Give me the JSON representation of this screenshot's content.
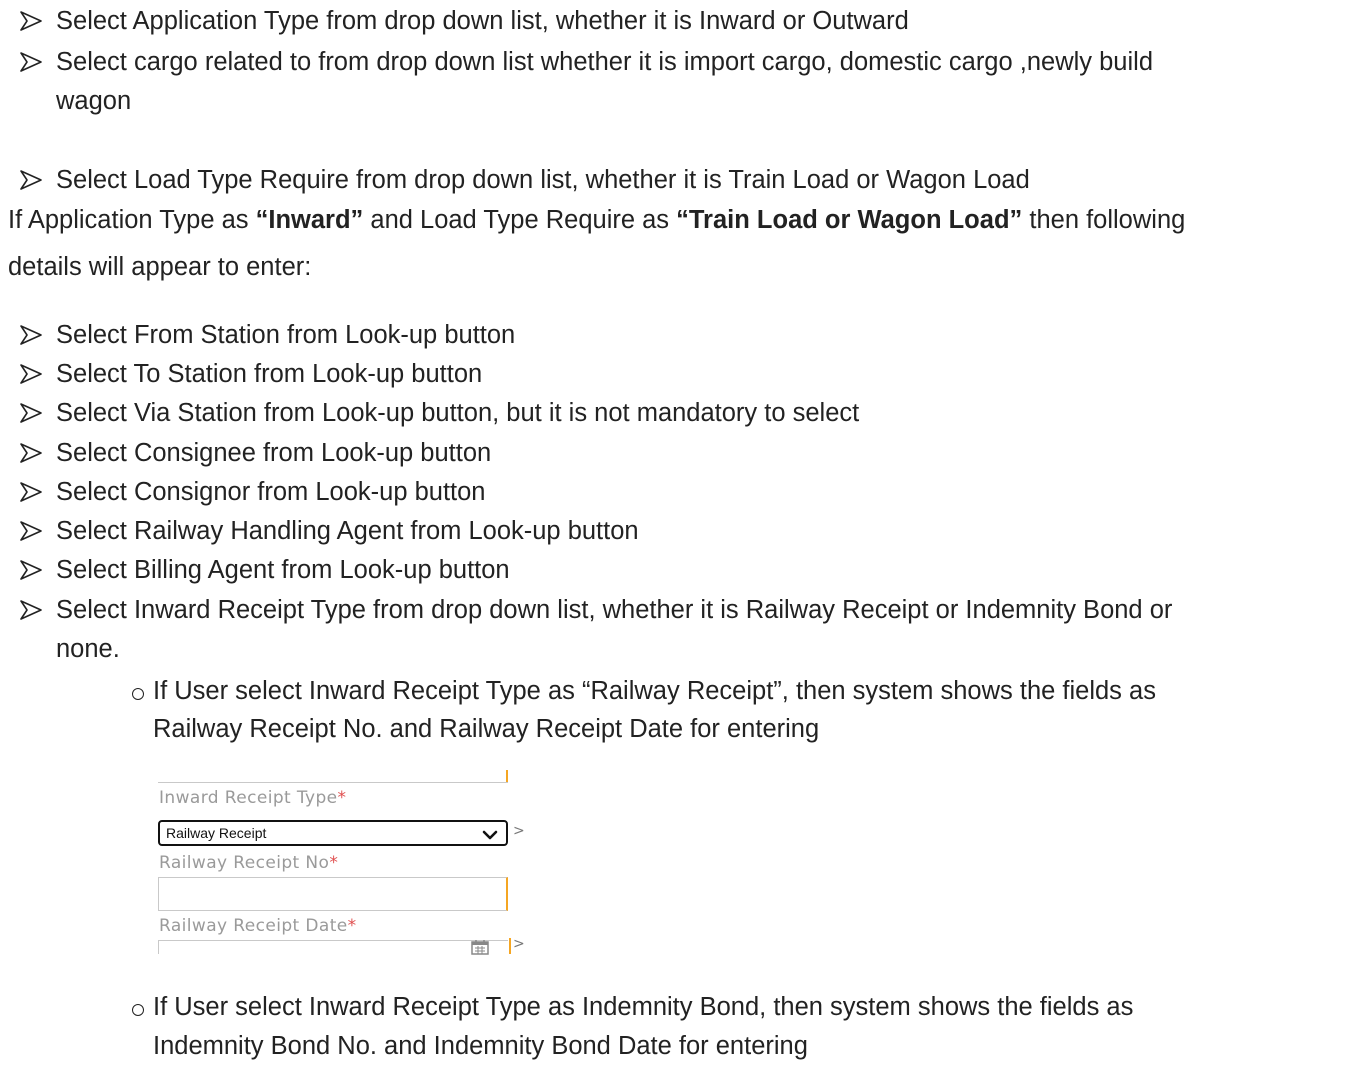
{
  "bullets": {
    "b1": "Select Application Type from drop down list, whether it is Inward or Outward",
    "b2_line1": "Select cargo related to from drop down list whether it is import cargo, domestic cargo ,newly build",
    "b2_line2": "wagon",
    "b3": "Select Load Type Require from drop down list, whether it is Train Load or Wagon Load"
  },
  "paragraph": {
    "p1_a": "If Application Type as ",
    "p1_b": "“Inward”",
    "p1_c": " and Load Type Require as ",
    "p1_d": "“Train Load or Wagon Load”",
    "p1_e": " then following",
    "p2": "details will appear to enter:"
  },
  "list": {
    "from_station": "Select From Station from Look-up button",
    "to_station": "Select To Station from Look-up button",
    "via_station": "Select Via Station from Look-up button, but it is not mandatory to select",
    "consignee": "Select Consignee from Look-up button",
    "consignor": "Select Consignor from Look-up button",
    "rha": "Select Railway Handling Agent from Look-up button",
    "billing_agent": "Select Billing Agent from Look-up button",
    "receipt_type_line1": "Select Inward Receipt Type from drop down list, whether it is Railway Receipt or Indemnity Bond or",
    "receipt_type_line2": "none."
  },
  "sub": {
    "rr_line1": "If User select Inward Receipt Type as “Railway Receipt”, then system shows the fields as",
    "rr_line2": "Railway Receipt No. and Railway Receipt Date for entering",
    "ib_line1": "If User select Inward Receipt Type as Indemnity Bond, then system shows the fields as",
    "ib_line2": "Indemnity Bond No. and Indemnity Bond Date for entering"
  },
  "form": {
    "receipt_type_label": "Inward Receipt Type",
    "receipt_type_value": "Railway Receipt",
    "rr_no_label": "Railway Receipt No",
    "rr_date_label": "Railway Receipt Date",
    "required_mark": "*",
    "side_arrow": ">"
  },
  "colors": {
    "text": "#222222",
    "accent_orange": "#f5a623",
    "required_red": "#e05050",
    "label_grey": "#9a9a9a"
  }
}
